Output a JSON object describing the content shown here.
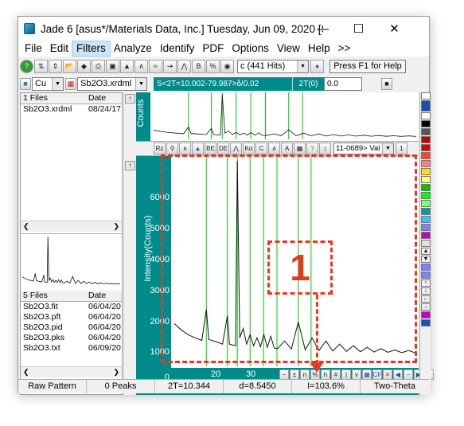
{
  "window": {
    "title": "Jade 6 [asus*/Materials Data, Inc.] Tuesday, Jun 09, 2020 [Sb..."
  },
  "menu": [
    "File",
    "Edit",
    "Filters",
    "Analyze",
    "Identify",
    "PDF",
    "Options",
    "View",
    "Help",
    ">>"
  ],
  "toolbar": {
    "hits_label": "c (441 Hits)",
    "help_label": "Press F1 for Help"
  },
  "toolbar2": {
    "element": "Cu",
    "file": "Sb2O3.xrdml",
    "readout": "S<2T=10.002-79.987>δ/0.02",
    "twotheta_label": "2T(0)",
    "twotheta_value": "0.0"
  },
  "files_top": {
    "header": "1 Files",
    "date_header": "Date",
    "rows": [
      {
        "name": "Sb2O3.xrdml",
        "date": "08/24/17"
      }
    ]
  },
  "files_bottom": {
    "header": "5 Files",
    "date_header": "Date",
    "rows": [
      {
        "name": "Sb2O3.fit",
        "date": "06/04/20"
      },
      {
        "name": "Sb2O3.pft",
        "date": "06/04/20"
      },
      {
        "name": "Sb2O3.pid",
        "date": "06/04/20"
      },
      {
        "name": "Sb2O3.pks",
        "date": "06/04/20"
      },
      {
        "name": "Sb2O3.txt",
        "date": "06/09/20"
      }
    ]
  },
  "plot_toolbar": {
    "pdf_card": "11-0689> Val",
    "counter": "1"
  },
  "overview": {
    "ylabel": "Counts"
  },
  "chart_data": {
    "type": "line",
    "xlabel": "",
    "ylabel": "Intensity(Counts)",
    "yticks": [
      "6000",
      "5000",
      "4000",
      "3000",
      "2000",
      "1000",
      "0"
    ],
    "xticks": [
      "20",
      "30"
    ],
    "ylim": [
      0,
      6600
    ],
    "xlim": [
      10,
      80
    ],
    "series": [
      {
        "values_x": [
          10,
          12,
          14,
          16,
          18,
          19.3,
          20,
          22,
          24,
          25.4,
          26,
          27.8,
          28.3,
          29,
          30,
          31,
          32,
          33,
          34,
          35,
          36,
          37,
          38,
          39,
          40,
          42,
          44,
          46,
          48,
          50,
          52,
          54,
          56,
          58,
          60,
          62,
          64,
          66,
          68,
          70,
          72,
          74,
          76,
          78,
          80
        ],
        "values_y": [
          1350,
          1150,
          1000,
          900,
          820,
          1800,
          850,
          780,
          700,
          1600,
          700,
          650,
          6500,
          900,
          1200,
          700,
          1000,
          650,
          900,
          620,
          1000,
          600,
          950,
          580,
          560,
          800,
          550,
          1400,
          520,
          900,
          500,
          800,
          480,
          700,
          470,
          650,
          460,
          600,
          450,
          560,
          440,
          520,
          430,
          500,
          420
        ]
      }
    ],
    "reference_lines_x": [
      19.3,
      25.4,
      28.3,
      32.0,
      35.9,
      39.8,
      46.0,
      49.7
    ]
  },
  "callout": {
    "label": "1"
  },
  "status": [
    "Raw Pattern",
    "0 Peaks",
    "2T=10.344",
    "d=8.5450",
    "I=103.6%",
    "Two-Theta"
  ]
}
